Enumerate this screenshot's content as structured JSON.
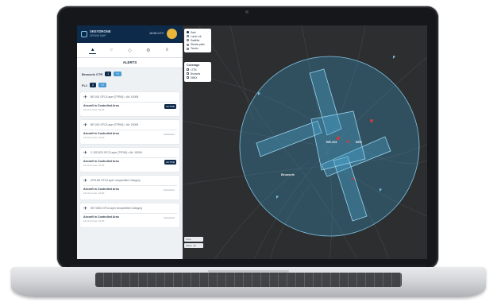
{
  "header": {
    "app_name": "SKEYDRONE",
    "app_subtitle": "DRONE MAP",
    "clock": "16:56 UTC"
  },
  "tabs": [
    {
      "icon": "bell-icon"
    },
    {
      "icon": "globe-icon"
    },
    {
      "icon": "shield-icon"
    },
    {
      "icon": "settings-icon"
    },
    {
      "icon": "menu-icon"
    }
  ],
  "alerts": {
    "title": "ALERTS",
    "zone_label": "Brussels CTR",
    "zone_chips": [
      "1",
      "+1"
    ],
    "fl_label": "FL1",
    "fl_chips": [
      "2",
      "+2"
    ],
    "cards": [
      {
        "code": "BR-001",
        "range": "GFC/Layer [TFRM] < Alt: 1500ft",
        "title": "Aircraft in Controlled Area",
        "time": "12:14 in time: 10.00",
        "status": "ACTIVE",
        "active": true
      },
      {
        "code": "BR-002",
        "range": "GFC/Layer [TFRM] < Alt: 1500ft",
        "title": "Aircraft in Controlled Area",
        "time": "12:14 in time: 10.00",
        "status": "Scheduled",
        "active": false
      },
      {
        "code": "C-DS1029",
        "range": "GFC/Layer [TFRM] < Alt: 1500ft",
        "title": "Aircraft in Controlled Area",
        "time": "12:14 in time: 10.00",
        "status": "ACTIVE",
        "active": true
      },
      {
        "code": "UPH-88",
        "range": "GFC/Layer Unspecified Category",
        "title": "Aircraft in Controlled Area",
        "time": "12:14 in time: 10.00",
        "status": "Scheduled",
        "active": false
      },
      {
        "code": "SKY4052",
        "range": "GFC/Layer Unspecified Category",
        "title": "Aircraft in Controlled Area",
        "time": "12:14 in time: 10.00",
        "status": "Scheduled",
        "active": false
      }
    ]
  },
  "map_style": {
    "title": "",
    "options": [
      {
        "label": "Dark",
        "selected": true
      },
      {
        "label": "Lunar Ldr",
        "selected": false
      },
      {
        "label": "Satellite",
        "selected": false
      },
      {
        "label": "Streets plain",
        "selected": false
      },
      {
        "label": "Terrain",
        "selected": false
      }
    ]
  },
  "coverage": {
    "title": "Coverage",
    "options": [
      {
        "label": "LTTB",
        "checked": false
      },
      {
        "label": "Brussels",
        "checked": false
      },
      {
        "label": "EBBX",
        "checked": false
      }
    ]
  },
  "map_labels": {
    "brussels": "Brussels",
    "tag1": "BR-001",
    "tag2": "BR2"
  },
  "zoom": {
    "line1": "1 km",
    "line2": "Zoom: 12"
  },
  "colors": {
    "sidebar_header": "#0e2a4a",
    "accent": "#4b9cd3",
    "zone_fill": "#3d8fb8",
    "zone_stroke": "#7fc4e6",
    "alert_marker": "#d23a3a",
    "avatar": "#e8b53a"
  }
}
